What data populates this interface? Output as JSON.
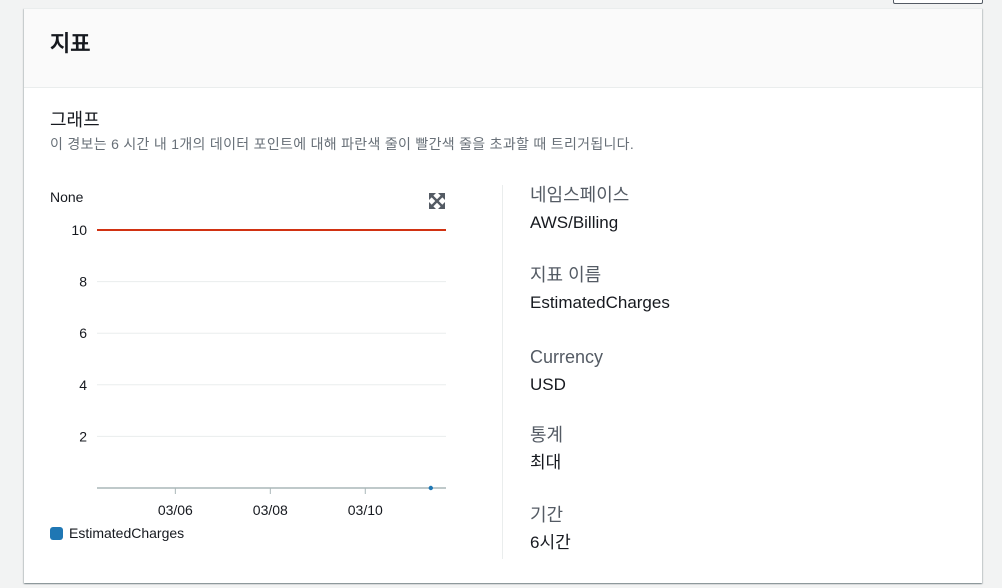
{
  "panel": {
    "title": "지표"
  },
  "graph": {
    "section_title": "그래프",
    "description": "이 경보는 6 시간 내 1개의 데이터 포인트에 대해 파란색 줄이 빨간색 줄을 초과할 때 트리거됩니다.",
    "expand_icon": "expand-arrows-icon"
  },
  "details": [
    {
      "key": "네임스페이스",
      "value": "AWS/Billing"
    },
    {
      "key": "지표 이름",
      "value": "EstimatedCharges"
    },
    {
      "key": "Currency",
      "value": "USD"
    },
    {
      "key": "통계",
      "value": "최대"
    },
    {
      "key": "기간",
      "value": "6시간"
    }
  ],
  "chart_data": {
    "type": "line",
    "ylabel": "None",
    "ylim": [
      0,
      10
    ],
    "y_ticks": [
      2,
      4,
      6,
      8,
      10
    ],
    "x_ticks": [
      "03/06",
      "03/08",
      "03/10"
    ],
    "threshold": {
      "value": 10,
      "color": "#d13212"
    },
    "series": [
      {
        "name": "EstimatedCharges",
        "color": "#1f77b4",
        "points": [
          {
            "x": "03/11",
            "y": 0
          }
        ]
      }
    ]
  }
}
